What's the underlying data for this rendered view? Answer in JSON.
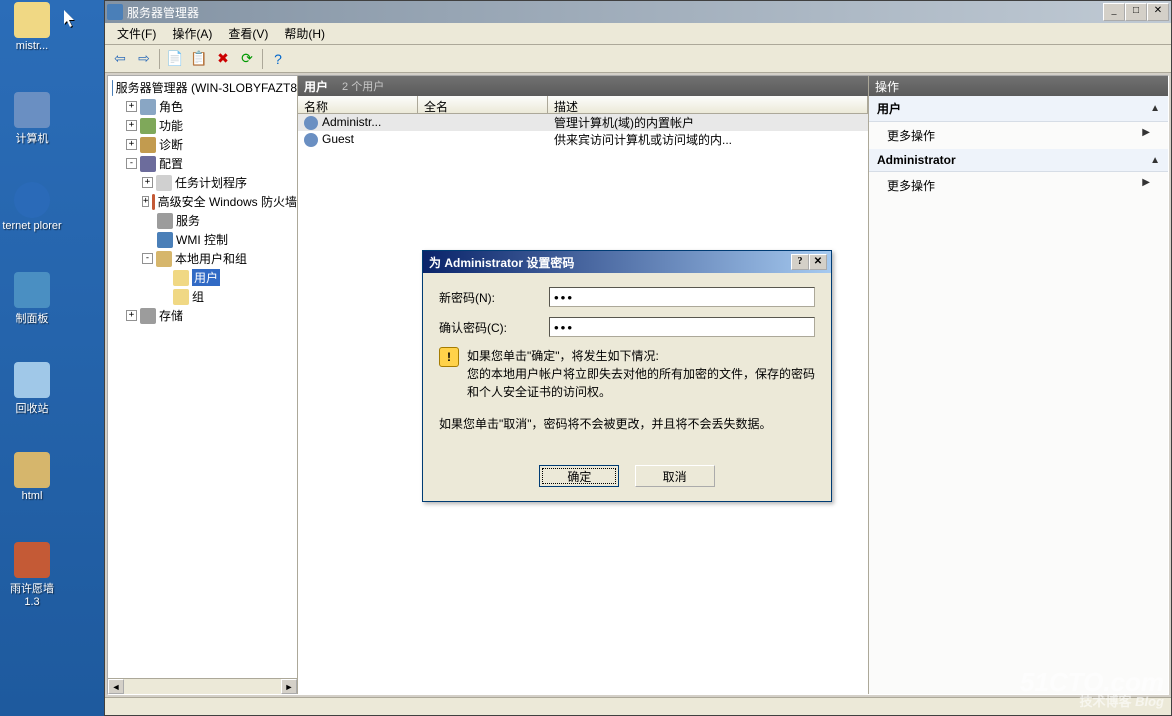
{
  "desktop": {
    "icons": [
      {
        "label": "mistr..."
      },
      {
        "label": "计算机"
      },
      {
        "label": "ternet\nplorer"
      },
      {
        "label": "制面板"
      },
      {
        "label": "回收站"
      },
      {
        "label": "html"
      },
      {
        "label": "雨许愿墙\n1.3"
      }
    ]
  },
  "window": {
    "title": "服务器管理器",
    "menus": [
      "文件(F)",
      "操作(A)",
      "查看(V)",
      "帮助(H)"
    ]
  },
  "tree": {
    "root": "服务器管理器 (WIN-3LOBYFAZT8",
    "nodes": [
      {
        "label": "角色",
        "indent": 1,
        "exp": "+",
        "ico": "#89a6c4"
      },
      {
        "label": "功能",
        "indent": 1,
        "exp": "+",
        "ico": "#7fa85a"
      },
      {
        "label": "诊断",
        "indent": 1,
        "exp": "+",
        "ico": "#c29b4f"
      },
      {
        "label": "配置",
        "indent": 1,
        "exp": "-",
        "ico": "#6c6c9c"
      },
      {
        "label": "任务计划程序",
        "indent": 2,
        "exp": "+",
        "ico": "#d0d0d0"
      },
      {
        "label": "高级安全 Windows 防火墙",
        "indent": 2,
        "exp": "+",
        "ico": "#c45a36"
      },
      {
        "label": "服务",
        "indent": 2,
        "exp": "",
        "ico": "#9c9c9c"
      },
      {
        "label": "WMI 控制",
        "indent": 2,
        "exp": "",
        "ico": "#4a7fb8"
      },
      {
        "label": "本地用户和组",
        "indent": 2,
        "exp": "-",
        "ico": "#d6b66c"
      },
      {
        "label": "用户",
        "indent": 3,
        "exp": "",
        "sel": true,
        "ico": "#f0d884"
      },
      {
        "label": "组",
        "indent": 3,
        "exp": "",
        "ico": "#f0d884"
      },
      {
        "label": "存储",
        "indent": 1,
        "exp": "+",
        "ico": "#9c9c9c"
      }
    ]
  },
  "mid": {
    "title": "用户",
    "subtitle": "2 个用户",
    "columns": [
      "名称",
      "全名",
      "描述"
    ],
    "rows": [
      {
        "name": "Administr...",
        "full": "",
        "desc": "管理计算机(域)的内置帐户",
        "sel": true
      },
      {
        "name": "Guest",
        "full": "",
        "desc": "供来宾访问计算机或访问域的内..."
      }
    ]
  },
  "actions": {
    "header": "操作",
    "sections": [
      {
        "title": "用户",
        "items": [
          "更多操作"
        ]
      },
      {
        "title": "Administrator",
        "items": [
          "更多操作"
        ]
      }
    ]
  },
  "dialog": {
    "title": "为 Administrator 设置密码",
    "label_new": "新密码(N):",
    "label_confirm": "确认密码(C):",
    "pw_value": "●●●",
    "warn1": "如果您单击\"确定\"，将发生如下情况:",
    "warn2": "您的本地用户帐户将立即失去对他的所有加密的文件，保存的密码和个人安全证书的访问权。",
    "text2": "如果您单击\"取消\"，密码将不会被更改，并且将不会丢失数据。",
    "ok": "确定",
    "cancel": "取消"
  },
  "watermark": {
    "main": "51CTO.com",
    "sub": "技术博客",
    "tag": "Blog"
  }
}
